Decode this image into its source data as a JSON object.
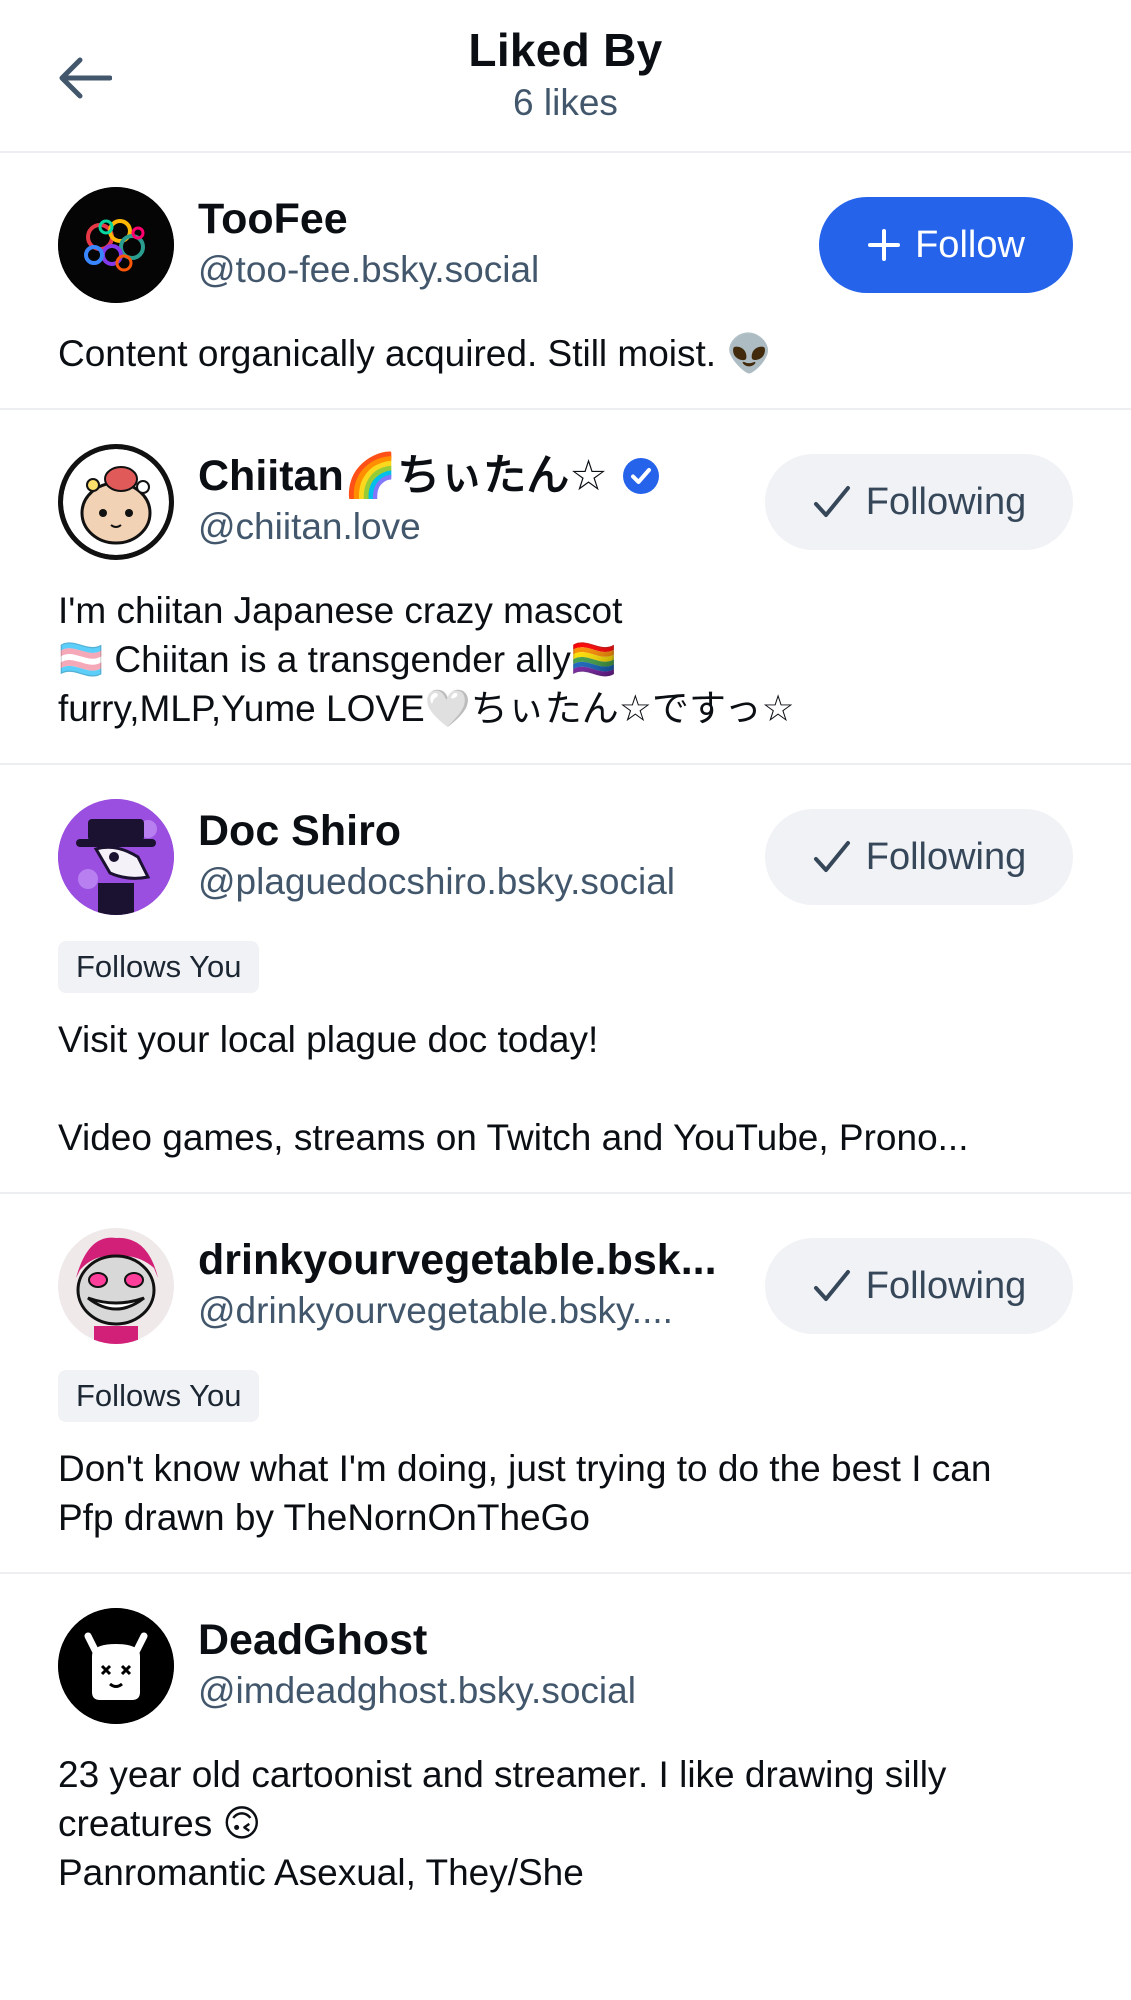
{
  "header": {
    "title": "Liked By",
    "subtitle": "6 likes"
  },
  "users": [
    {
      "display_name": "TooFee",
      "handle": "@too-fee.bsky.social",
      "button": "Follow",
      "bio": "Content organically acquired. Still moist. 👽"
    },
    {
      "display_name": "Chiitan🌈ちぃたん☆",
      "handle": "@chiitan.love",
      "button": "Following",
      "verified": true,
      "bio": "I'm chiitan Japanese crazy mascot\n🏳️‍⚧️ Chiitan is a transgender ally🏳️‍🌈\nfurry,MLP,Yume LOVE🤍ちぃたん☆ですっ☆"
    },
    {
      "display_name": "Doc Shiro",
      "handle": "@plaguedocshiro.bsky.social",
      "button": "Following",
      "badge": "Follows You",
      "bio": "Visit your local plague doc today!\n\nVideo games, streams on Twitch and YouTube, Prono..."
    },
    {
      "display_name": "drinkyourvegetable.bsk...",
      "handle": "@drinkyourvegetable.bsky....",
      "button": "Following",
      "badge": "Follows You",
      "bio": "Don't know what I'm doing, just trying to do the best I can\nPfp drawn by TheNornOnTheGo"
    },
    {
      "display_name": "DeadGhost",
      "handle": "@imdeadghost.bsky.social",
      "bio": "23 year old cartoonist and streamer. I like drawing silly creatures 🙃\nPanromantic Asexual, They/She"
    }
  ],
  "colors": {
    "accent": "#2563eb",
    "secondary_text": "#42576c",
    "following_bg": "#f0f2f5",
    "divider": "#eceef1"
  },
  "icons": {
    "back": "arrow-left-icon",
    "follow": "plus-icon",
    "following": "check-icon",
    "verified": "verified-check-icon"
  }
}
